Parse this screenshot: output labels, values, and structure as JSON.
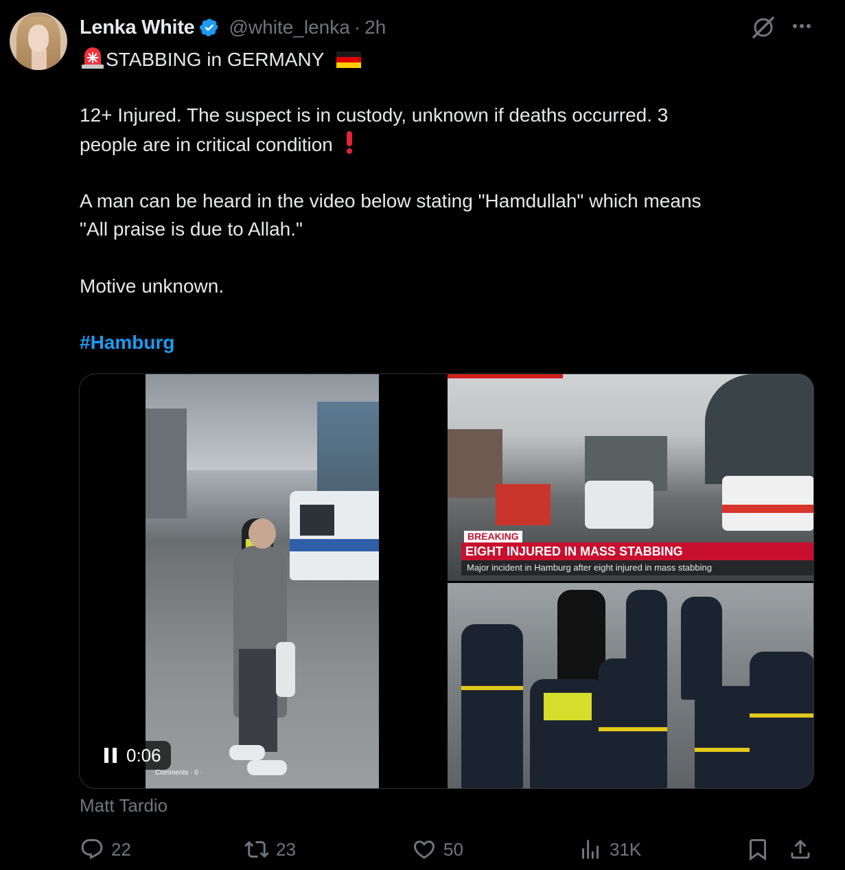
{
  "tweet": {
    "author_name": "Lenka White",
    "handle": "@white_lenka",
    "separator": "·",
    "time": "2h",
    "title_line": "STABBING in GERMANY",
    "paragraph1_line1": "12+ Injured. The suspect is in custody, unknown if deaths occurred. 3",
    "paragraph1_line2": "people are in critical condition",
    "paragraph2_line1": "A man can be heard in the video below stating \"Hamdullah\" which means",
    "paragraph2_line2": "\"All praise is due to Allah.\"",
    "paragraph3": "Motive unknown.",
    "hashtag": "#Hamburg"
  },
  "media": {
    "video_time": "0:06",
    "video_overlay_text": "Comments · 0 ·",
    "news_breaking": "BREAKING",
    "news_headline": "EIGHT INJURED IN MASS STABBING",
    "news_subline": "Major incident in Hamburg after eight injured in mass stabbing",
    "attribution": "Matt Tardio"
  },
  "actions": {
    "replies": "22",
    "reposts": "23",
    "likes": "50",
    "views": "31K"
  },
  "icons": {
    "verified": "verified-badge-icon",
    "grok": "grok-icon",
    "more": "more-icon",
    "siren": "police-light-emoji",
    "flag": "germany-flag-emoji",
    "exclamation": "red-exclamation-emoji",
    "reply": "reply-icon",
    "repost": "repost-icon",
    "like": "heart-icon",
    "views": "views-icon",
    "bookmark": "bookmark-icon",
    "share": "share-icon"
  },
  "colors": {
    "background": "#000000",
    "text": "#e7e9ea",
    "muted": "#71767b",
    "accent": "#1d9bf0"
  }
}
